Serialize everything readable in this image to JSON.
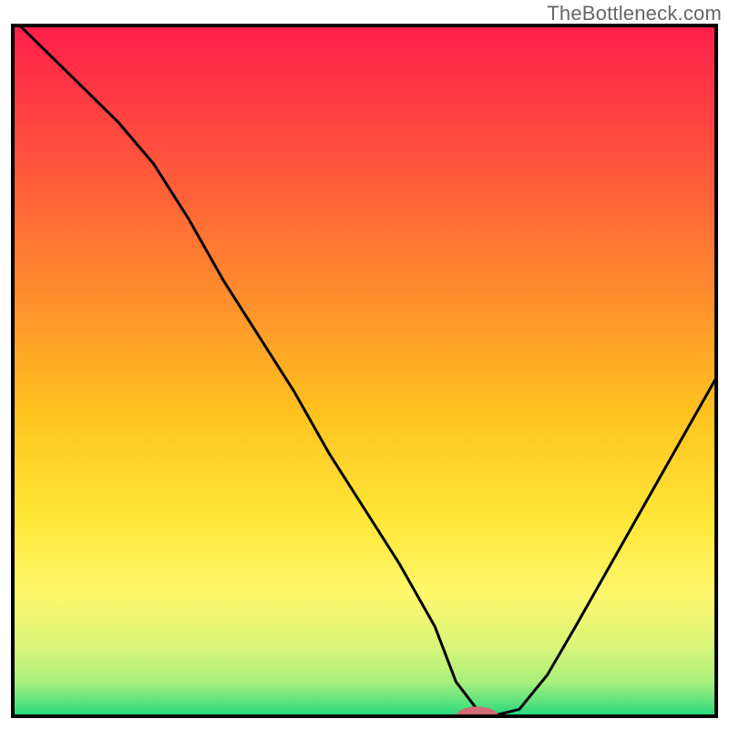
{
  "watermark": {
    "text": "TheBottleneck.com"
  },
  "chart_data": {
    "type": "line",
    "title": "",
    "xlabel": "",
    "ylabel": "",
    "xlim": [
      0,
      100
    ],
    "ylim": [
      0,
      100
    ],
    "x": [
      0,
      5,
      10,
      15,
      20,
      25,
      30,
      35,
      40,
      45,
      50,
      55,
      60,
      63,
      66,
      68,
      72,
      76,
      80,
      85,
      90,
      95,
      100
    ],
    "values": [
      101,
      96,
      91,
      86,
      80,
      72,
      63,
      55,
      47,
      38,
      30,
      22,
      13,
      5,
      1,
      0,
      1,
      6,
      13,
      22,
      31,
      40,
      49
    ],
    "marker": {
      "x": 66,
      "y": 0,
      "rx": 3,
      "ry": 1.4,
      "color": "#d36a77"
    },
    "frame": {
      "visible": true,
      "color": "#000000",
      "width": 4
    },
    "gradient_stops": [
      {
        "offset": 0.0,
        "color": "#ff1e4a"
      },
      {
        "offset": 0.18,
        "color": "#ff4f3d"
      },
      {
        "offset": 0.38,
        "color": "#ff8a2e"
      },
      {
        "offset": 0.56,
        "color": "#ffc21e"
      },
      {
        "offset": 0.72,
        "color": "#ffe83a"
      },
      {
        "offset": 0.82,
        "color": "#fff76a"
      },
      {
        "offset": 0.9,
        "color": "#d9f57a"
      },
      {
        "offset": 0.95,
        "color": "#a9ef7c"
      },
      {
        "offset": 0.985,
        "color": "#4de07e"
      },
      {
        "offset": 1.0,
        "color": "#1fd67a"
      }
    ],
    "line_style": {
      "color": "#000000",
      "width": 3
    }
  }
}
